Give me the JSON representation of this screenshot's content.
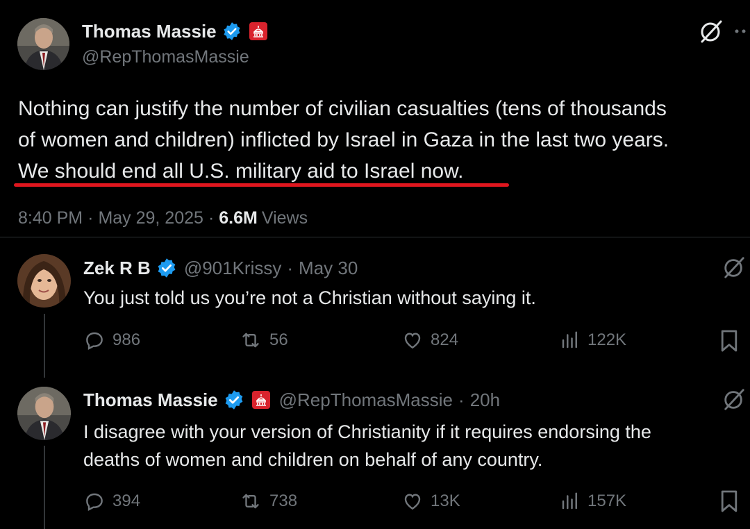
{
  "main_tweet": {
    "author_name": "Thomas Massie",
    "author_handle": "@RepThomasMassie",
    "text_line1": "Nothing can justify the number of civilian casualties (tens of thousands",
    "text_line2": "of women and children)  inflicted by Israel in Gaza in the last two years.",
    "text_line3": "We should end all U.S. military aid to Israel now.",
    "time": "8:40 PM",
    "date": "May 29, 2025",
    "views_count": "6.6M",
    "views_label": "Views",
    "separator": "·",
    "more_icon": "more-dots-icon",
    "grok_icon": "grok-icon"
  },
  "replies": [
    {
      "author_name": "Zek R B",
      "author_handle": "@901Krissy",
      "time": "May 30",
      "text_line1": "You just told us you’re not a Christian without saying it.",
      "text_line2": "",
      "replies": "986",
      "reposts": "56",
      "likes": "824",
      "views": "122K"
    },
    {
      "author_name": "Thomas Massie",
      "author_handle": "@RepThomasMassie",
      "time": "20h",
      "text_line1": "I disagree with your version of Christianity if it requires endorsing the",
      "text_line2": "deaths of women and children on behalf of any country.",
      "replies": "394",
      "reposts": "738",
      "likes": "13K",
      "views": "157K"
    }
  ],
  "colors": {
    "background": "#000000",
    "text": "#e7e9ea",
    "muted": "#71767b",
    "verified": "#1d9bf0",
    "underline": "#e0161e",
    "gov_badge": "#d9232d"
  }
}
